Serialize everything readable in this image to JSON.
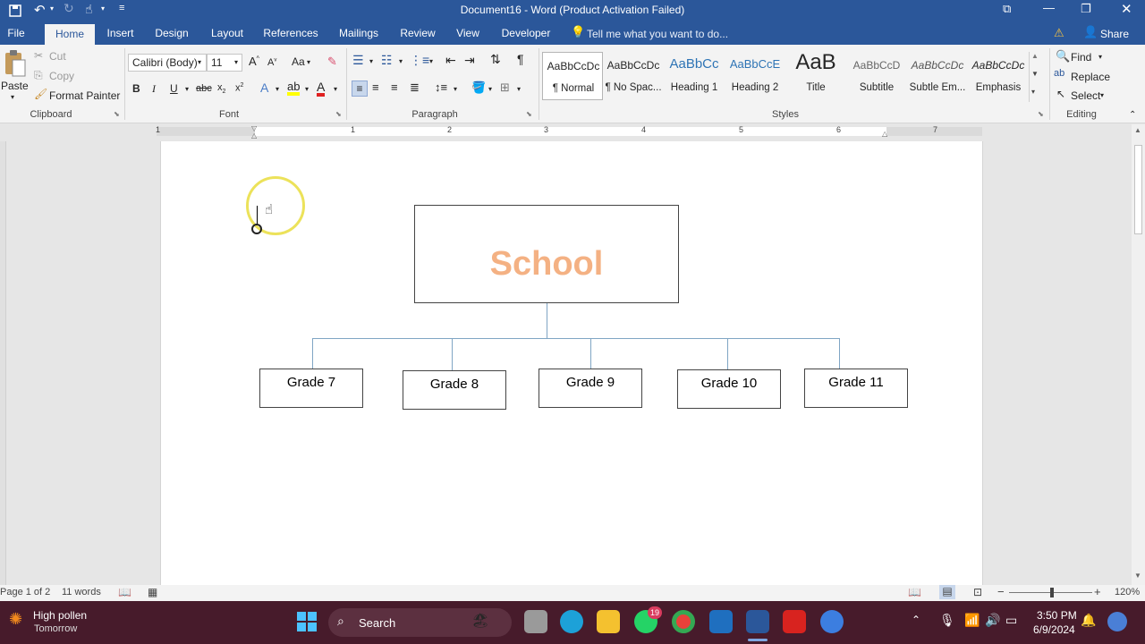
{
  "window": {
    "title": "Document16 - Word (Product Activation Failed)"
  },
  "tabs": [
    {
      "label": "File"
    },
    {
      "label": "Home"
    },
    {
      "label": "Insert"
    },
    {
      "label": "Design"
    },
    {
      "label": "Layout"
    },
    {
      "label": "References"
    },
    {
      "label": "Mailings"
    },
    {
      "label": "Review"
    },
    {
      "label": "View"
    },
    {
      "label": "Developer"
    }
  ],
  "tell_me": {
    "placeholder": "Tell me what you want to do..."
  },
  "share_label": "Share",
  "clipboard": {
    "paste": "Paste",
    "cut": "Cut",
    "copy": "Copy",
    "format_painter": "Format Painter",
    "label": "Clipboard"
  },
  "font": {
    "name": "Calibri (Body)",
    "size": "11",
    "label": "Font",
    "change_case": "Aa"
  },
  "paragraph": {
    "label": "Paragraph"
  },
  "styles": {
    "label": "Styles",
    "items": [
      {
        "preview": "AaBbCcDc",
        "name": "¶ Normal"
      },
      {
        "preview": "AaBbCcDc",
        "name": "¶ No Spac..."
      },
      {
        "preview": "AaBbCc",
        "name": "Heading 1"
      },
      {
        "preview": "AaBbCcE",
        "name": "Heading 2"
      },
      {
        "preview": "AaB",
        "name": "Title"
      },
      {
        "preview": "AaBbCcD",
        "name": "Subtitle"
      },
      {
        "preview": "AaBbCcDc",
        "name": "Subtle Em..."
      },
      {
        "preview": "AaBbCcDc",
        "name": "Emphasis"
      }
    ]
  },
  "editing": {
    "find": "Find",
    "replace": "Replace",
    "select": "Select",
    "label": "Editing"
  },
  "ruler_numbers": [
    "1",
    "1",
    "2",
    "3",
    "4",
    "5",
    "6",
    "7"
  ],
  "org_chart": {
    "root": "School",
    "children": [
      "Grade 7",
      "Grade 8",
      "Grade 9",
      "Grade 10",
      "Grade 11"
    ]
  },
  "status": {
    "page": "Page 1 of 2",
    "words": "11 words",
    "zoom": "120%"
  },
  "taskbar": {
    "weather_title": "High pollen",
    "weather_sub": "Tomorrow",
    "search": "Search",
    "time": "3:50 PM",
    "date": "6/9/2024",
    "whatsapp_badge": "19"
  },
  "colors": {
    "word_blue": "#2b579a",
    "school_text": "#f4b183",
    "connector": "#7fa5c4",
    "taskbar": "#471b2b"
  }
}
